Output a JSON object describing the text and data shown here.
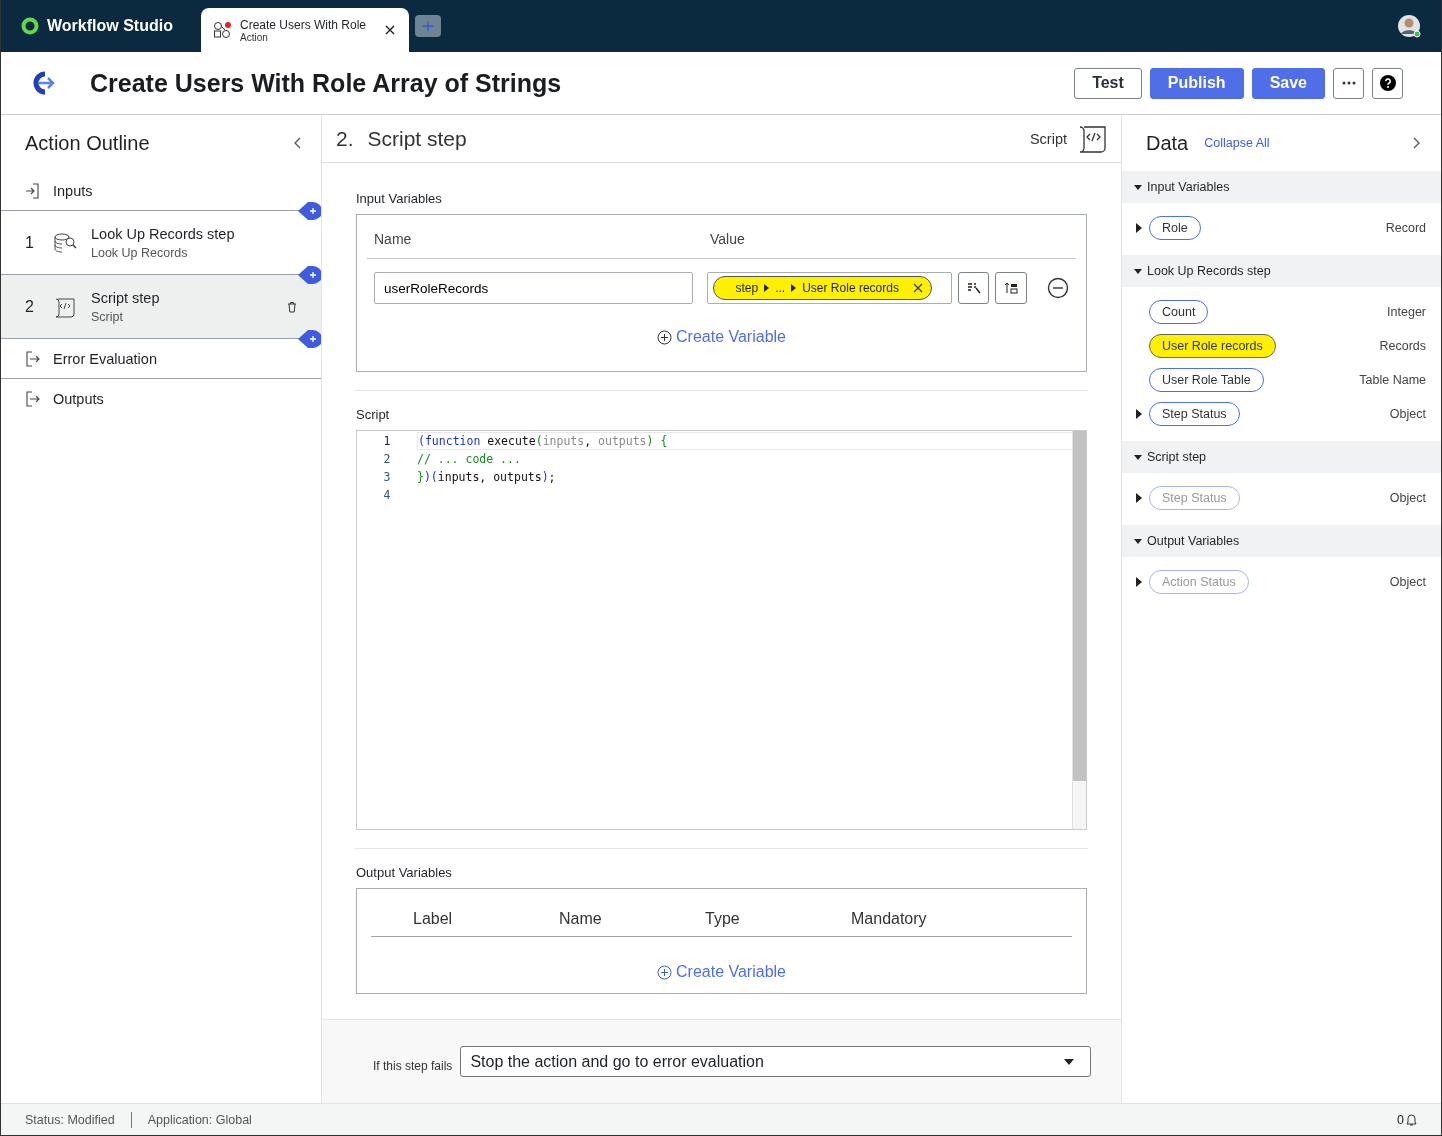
{
  "app": {
    "name": "Workflow Studio"
  },
  "tabs": [
    {
      "title": "Create Users With Role",
      "subtitle": "Action",
      "selected": true,
      "modified": true
    }
  ],
  "header": {
    "title": "Create Users With Role Array of Strings",
    "buttons": [
      {
        "label": "Test",
        "kind": "secondary"
      },
      {
        "label": "Publish",
        "kind": "primary"
      },
      {
        "label": "Save",
        "kind": "primary"
      }
    ]
  },
  "outline": {
    "title": "Action Outline",
    "items": [
      {
        "kind": "io",
        "label": "Inputs",
        "selected": false
      },
      {
        "kind": "step",
        "number": "1",
        "label": "Look Up Records step",
        "subtitle": "Look Up Records",
        "selected": false
      },
      {
        "kind": "step",
        "number": "2",
        "label": "Script step",
        "subtitle": "Script",
        "selected": true
      },
      {
        "kind": "io",
        "label": "Error Evaluation",
        "selected": false
      },
      {
        "kind": "io",
        "label": "Outputs",
        "selected": false
      }
    ]
  },
  "step": {
    "number": "2.",
    "title": "Script step",
    "type": "Script"
  },
  "input_variables": {
    "label": "Input Variables",
    "columns": [
      "Name",
      "Value"
    ],
    "rows": [
      {
        "name": "userRoleRecords",
        "value": {
          "segments": [
            "step",
            "...",
            "User Role records"
          ],
          "highlighted": true
        }
      }
    ],
    "create_label": "Create Variable"
  },
  "script": {
    "label": "Script",
    "lines": [
      {
        "number": "1",
        "tokens": [
          {
            "text": "(",
            "kind": "kw"
          },
          {
            "text": "function",
            "kind": "kw"
          },
          {
            "text": " execute",
            "kind": "plain"
          },
          {
            "text": "(",
            "kind": "br"
          },
          {
            "text": "inputs",
            "kind": "param"
          },
          {
            "text": ", ",
            "kind": "plain"
          },
          {
            "text": "outputs",
            "kind": "param"
          },
          {
            "text": ") {",
            "kind": "br"
          }
        ]
      },
      {
        "number": "2",
        "tokens": [
          {
            "text": "// ... code ...",
            "kind": "comment"
          }
        ]
      },
      {
        "number": "3",
        "tokens": [
          {
            "text": "}",
            "kind": "br"
          },
          {
            "text": ")(",
            "kind": "kw"
          },
          {
            "text": "inputs, outputs",
            "kind": "plain"
          },
          {
            "text": ")",
            "kind": "kw"
          },
          {
            "text": ";",
            "kind": "plain"
          }
        ]
      },
      {
        "number": "4"
      }
    ]
  },
  "output_variables": {
    "label": "Output Variables",
    "columns": [
      "Label",
      "Name",
      "Type",
      "Mandatory"
    ],
    "create_label": "Create Variable"
  },
  "on_failure": {
    "label": "If this step fails",
    "value": "Stop the action and go to error evaluation"
  },
  "data_panel": {
    "title": "Data",
    "collapse_label": "Collapse All",
    "groups": [
      {
        "title": "Input Variables",
        "expanded": true,
        "items": [
          {
            "label": "Role",
            "type": "Record",
            "expandable": true,
            "highlighted": false,
            "disabled": false
          }
        ]
      },
      {
        "title": "Look Up Records step",
        "expanded": true,
        "items": [
          {
            "label": "Count",
            "type": "Integer",
            "expandable": false,
            "highlighted": false,
            "disabled": false
          },
          {
            "label": "User Role records",
            "type": "Records",
            "expandable": false,
            "highlighted": true,
            "disabled": false
          },
          {
            "label": "User Role Table",
            "type": "Table Name",
            "expandable": false,
            "highlighted": false,
            "disabled": false
          },
          {
            "label": "Step Status",
            "type": "Object",
            "expandable": true,
            "highlighted": false,
            "disabled": false
          }
        ]
      },
      {
        "title": "Script step",
        "expanded": true,
        "items": [
          {
            "label": "Step Status",
            "type": "Object",
            "expandable": true,
            "highlighted": false,
            "disabled": true
          }
        ]
      },
      {
        "title": "Output Variables",
        "expanded": true,
        "items": [
          {
            "label": "Action Status",
            "type": "Object",
            "expandable": true,
            "highlighted": false,
            "disabled": true
          }
        ]
      }
    ]
  },
  "status_bar": {
    "items": [
      "Status: Modified",
      "Application: Global"
    ],
    "notifications": "0"
  }
}
